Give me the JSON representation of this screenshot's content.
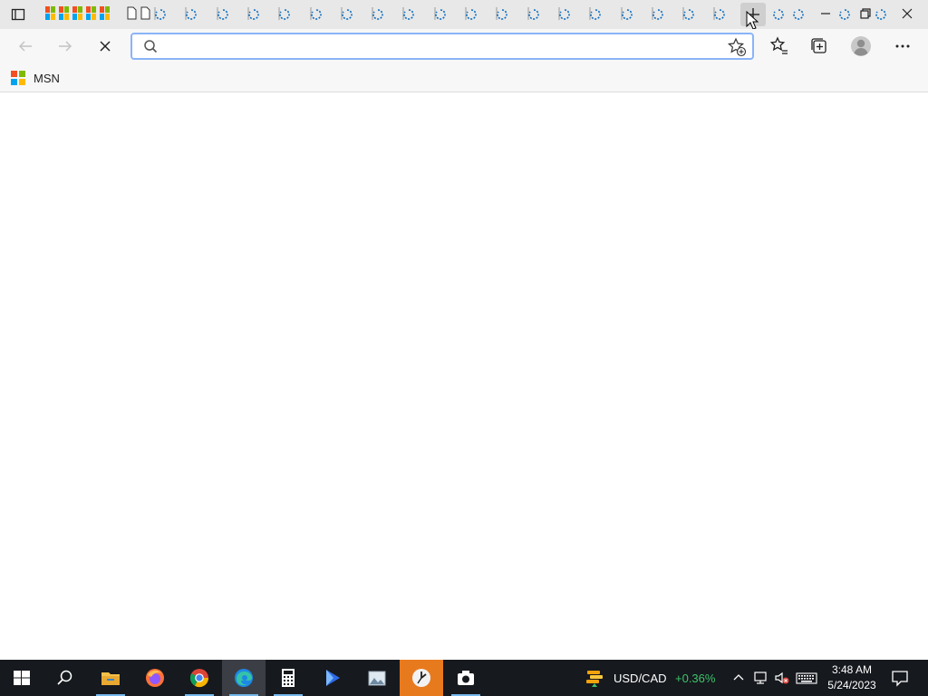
{
  "browser": {
    "tab_strip": {
      "pinned_tab_count": 5,
      "doc_tab_count": 2,
      "loading_tab_count": 20,
      "newtab_icon": "plus-icon"
    },
    "toolbar": {
      "back_icon": "arrow-left-icon",
      "forward_icon": "arrow-right-icon",
      "stop_icon": "close-icon",
      "address_value": "",
      "address_placeholder": "",
      "favorites_icon": "star-list-icon",
      "collections_icon": "collections-icon",
      "profile_icon": "avatar-icon",
      "menu_icon": "more-icon"
    },
    "favorites_bar": {
      "items": [
        {
          "label": "MSN"
        }
      ]
    }
  },
  "taskbar": {
    "apps": [
      "start",
      "search",
      "file-explorer",
      "firefox",
      "chrome",
      "edge",
      "calculator",
      "power-automate",
      "photos",
      "clock",
      "camera"
    ],
    "ticker": {
      "symbol": "USD/CAD",
      "change": "+0.36%"
    },
    "clock": {
      "time": "3:48 AM",
      "date": "5/24/2023"
    }
  },
  "colors": {
    "accent": "#8ab4f8",
    "taskbar": "#16191e",
    "ticker_up": "#3ec26a"
  }
}
